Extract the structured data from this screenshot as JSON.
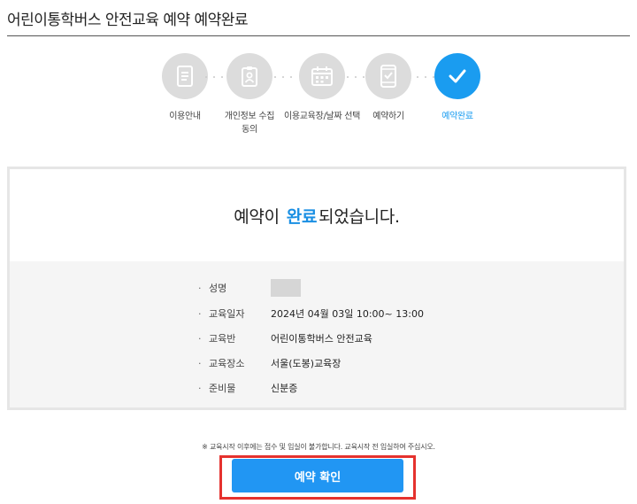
{
  "header": {
    "title": "어린이통학버스 안전교육 예약 예약완료"
  },
  "steps": [
    {
      "label": "이용안내",
      "icon": "document-icon"
    },
    {
      "label": "개인정보 수집 동의",
      "icon": "clipboard-person-icon"
    },
    {
      "label": "이용교육장/날짜 선택",
      "icon": "calendar-icon"
    },
    {
      "label": "예약하기",
      "icon": "phone-check-icon"
    },
    {
      "label": "예약완료",
      "icon": "checkmark-icon"
    }
  ],
  "result": {
    "prefix": "예약이",
    "accent": "완료",
    "suffix": "되었습니다."
  },
  "details": [
    {
      "key": "성명",
      "value": ""
    },
    {
      "key": "교육일자",
      "value": "2024년 04월 03일 10:00~ 13:00"
    },
    {
      "key": "교육반",
      "value": "어린이통학버스 안전교육"
    },
    {
      "key": "교육장소",
      "value": "서울(도봉)교육장"
    },
    {
      "key": "준비물",
      "value": "신분증"
    }
  ],
  "notice": "※ 교육시작 이후에는 접수 및 입실이 불가합니다. 교육시작 전 입실하여 주십시오.",
  "confirm_button": "예약 확인",
  "colors": {
    "accent": "#1a8fe3",
    "button": "#2196f3",
    "highlight": "#e5322e",
    "inactive_step": "#dcdcdc"
  }
}
